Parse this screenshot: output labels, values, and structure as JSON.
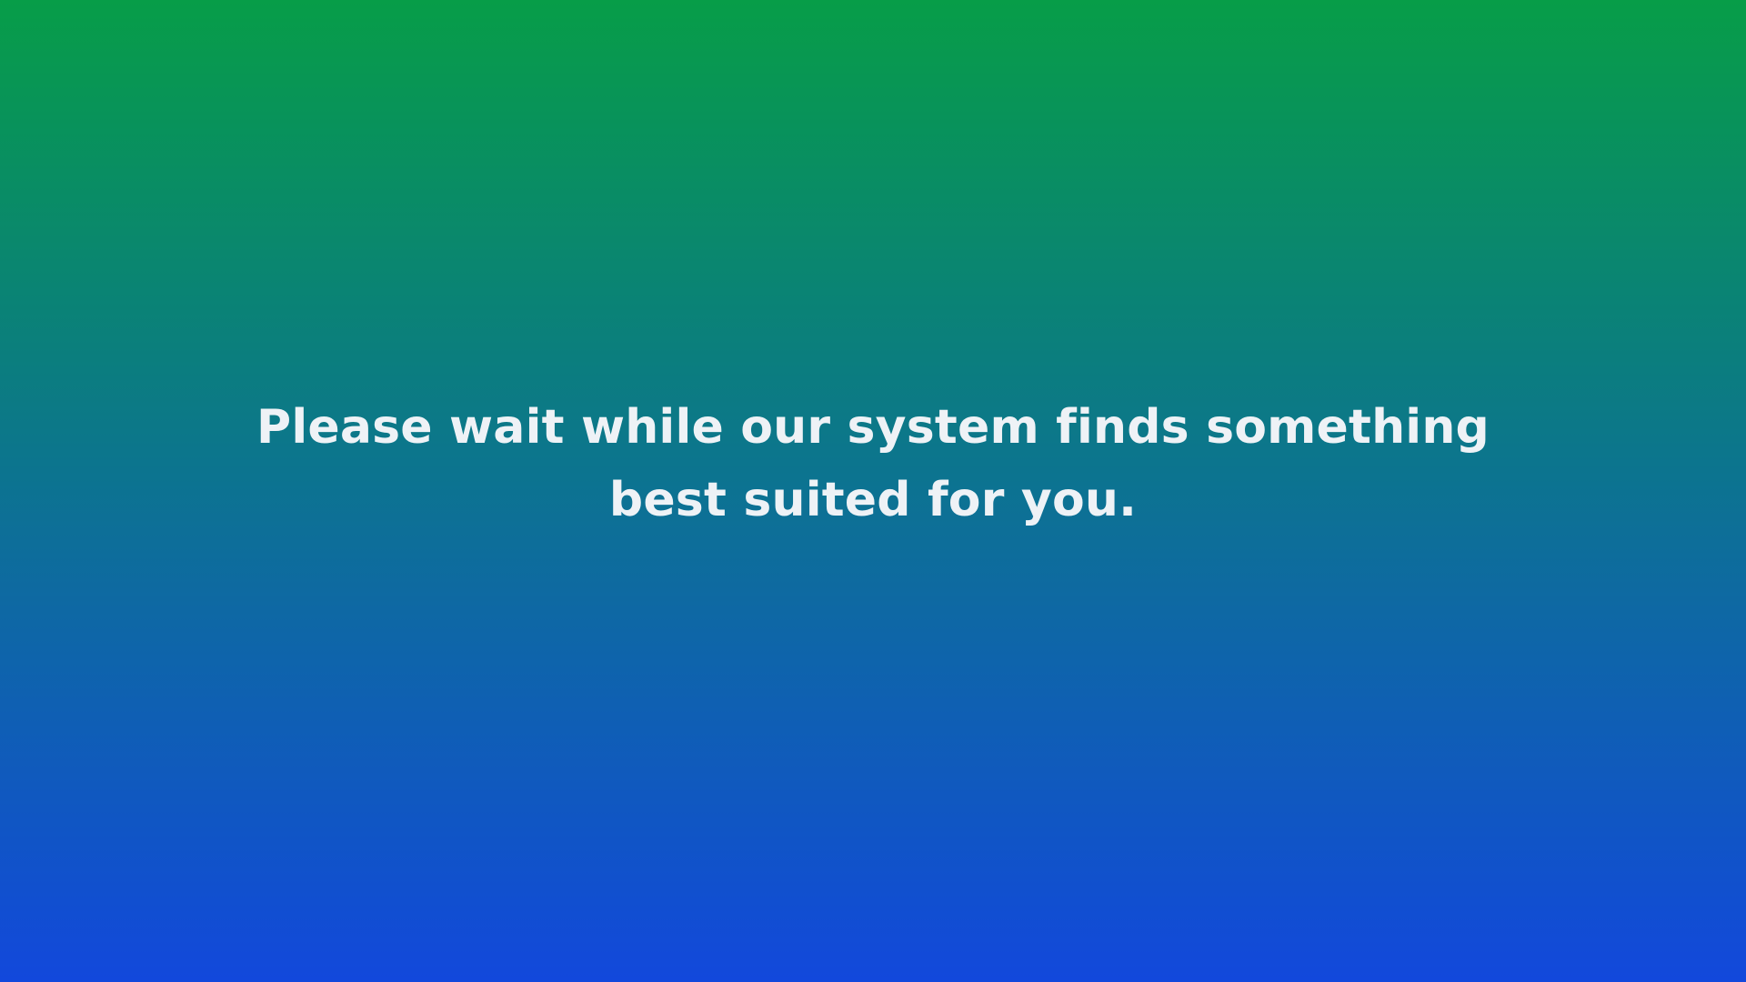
{
  "screen": {
    "background_top_color": "#079d48",
    "background_bottom_color": "#1248dc",
    "text_color": "#eef2f6",
    "message_lines": [
      "Please wait while our system finds something",
      "best suited for you."
    ]
  }
}
